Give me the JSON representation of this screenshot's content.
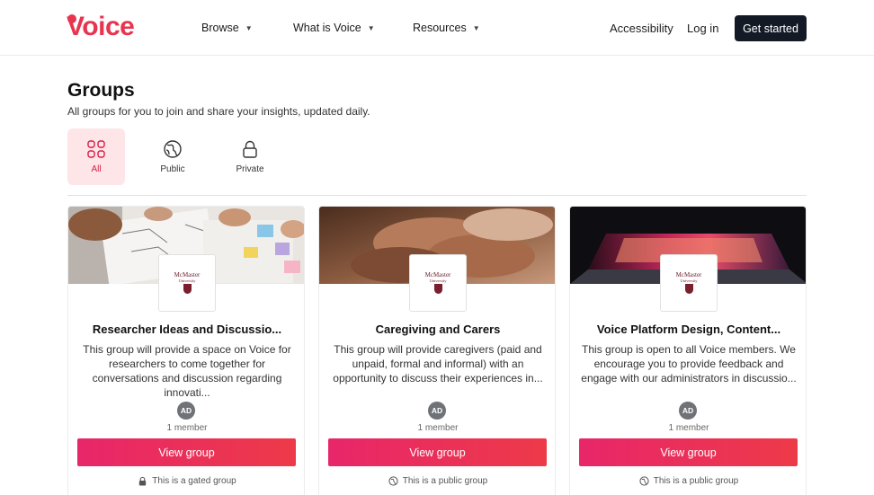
{
  "header": {
    "logo_text": "Voice",
    "nav": [
      {
        "label": "Browse"
      },
      {
        "label": "What is Voice"
      },
      {
        "label": "Resources"
      }
    ],
    "accessibility": "Accessibility",
    "login": "Log in",
    "cta": "Get started"
  },
  "page": {
    "title": "Groups",
    "subtitle": "All groups for you to join and share your insights, updated daily."
  },
  "filters": [
    {
      "label": "All",
      "icon": "grid-icon",
      "active": true
    },
    {
      "label": "Public",
      "icon": "globe-icon",
      "active": false
    },
    {
      "label": "Private",
      "icon": "lock-icon",
      "active": false
    }
  ],
  "org": {
    "name": "McMaster",
    "sub": "University"
  },
  "cards": [
    {
      "title": "Researcher Ideas and Discussio...",
      "description": "This group will provide a space on Voice for researchers to come together for conversations and discussion regarding innovati...",
      "avatar": "AD",
      "members": "1 member",
      "button": "View group",
      "access": "This is a gated group",
      "access_icon": "lock-icon"
    },
    {
      "title": "Caregiving and Carers",
      "description": "This group will provide caregivers (paid and unpaid, formal and informal) with an opportunity to discuss their experiences in...",
      "avatar": "AD",
      "members": "1 member",
      "button": "View group",
      "access": "This is a public group",
      "access_icon": "globe-icon"
    },
    {
      "title": "Voice Platform Design, Content...",
      "description": "This group is open to all Voice members. We encourage you to provide feedback and engage with our administrators in discussio...",
      "avatar": "AD",
      "members": "1 member",
      "button": "View group",
      "access": "This is a public group",
      "access_icon": "globe-icon"
    }
  ],
  "colors": {
    "brand": "#e8344e",
    "cta_bg": "#131a26",
    "active_filter_bg": "#fde5e8",
    "button_gradient_start": "#e8266a",
    "button_gradient_end": "#ed3a48"
  }
}
